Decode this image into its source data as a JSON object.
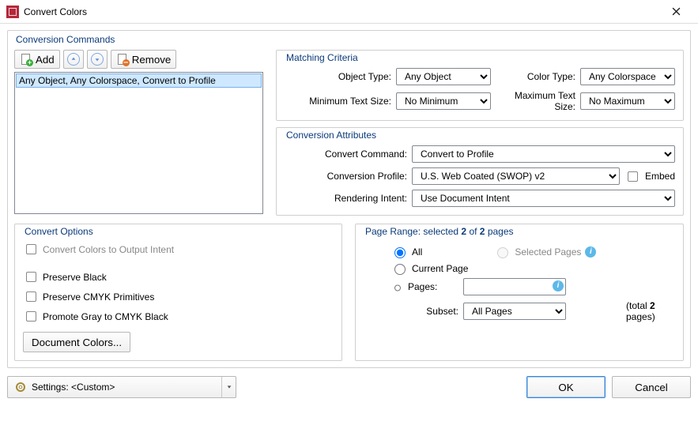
{
  "window": {
    "title": "Convert Colors"
  },
  "conversion_commands": {
    "title": "Conversion Commands",
    "add_label": "Add",
    "remove_label": "Remove",
    "items": [
      "Any Object, Any Colorspace, Convert to Profile"
    ]
  },
  "matching_criteria": {
    "title": "Matching Criteria",
    "object_type_label": "Object Type:",
    "object_type_value": "Any Object",
    "color_type_label": "Color Type:",
    "color_type_value": "Any Colorspace",
    "min_text_label": "Minimum Text Size:",
    "min_text_value": "No Minimum",
    "max_text_label": "Maximum Text Size:",
    "max_text_value": "No Maximum"
  },
  "conversion_attributes": {
    "title": "Conversion Attributes",
    "convert_command_label": "Convert Command:",
    "convert_command_value": "Convert to Profile",
    "conversion_profile_label": "Conversion Profile:",
    "conversion_profile_value": "U.S. Web Coated (SWOP) v2",
    "embed_label": "Embed",
    "rendering_intent_label": "Rendering Intent:",
    "rendering_intent_value": "Use Document Intent"
  },
  "convert_options": {
    "title": "Convert Options",
    "to_output_intent": "Convert Colors to Output Intent",
    "preserve_black": "Preserve Black",
    "preserve_cmyk": "Preserve CMYK Primitives",
    "promote_gray": "Promote Gray to CMYK Black",
    "document_colors": "Document Colors..."
  },
  "page_range": {
    "title_prefix": "Page Range: selected ",
    "selected": "2",
    "of": " of ",
    "total": "2",
    "title_suffix": " pages",
    "all": "All",
    "selected_pages": "Selected Pages",
    "current_page": "Current Page",
    "pages": "Pages:",
    "subset_label": "Subset:",
    "subset_value": "All Pages",
    "total_prefix": "(total ",
    "total_pages": "2",
    "total_suffix": " pages)"
  },
  "footer": {
    "settings_label": "Settings:",
    "settings_value": "<Custom>",
    "ok": "OK",
    "cancel": "Cancel"
  }
}
